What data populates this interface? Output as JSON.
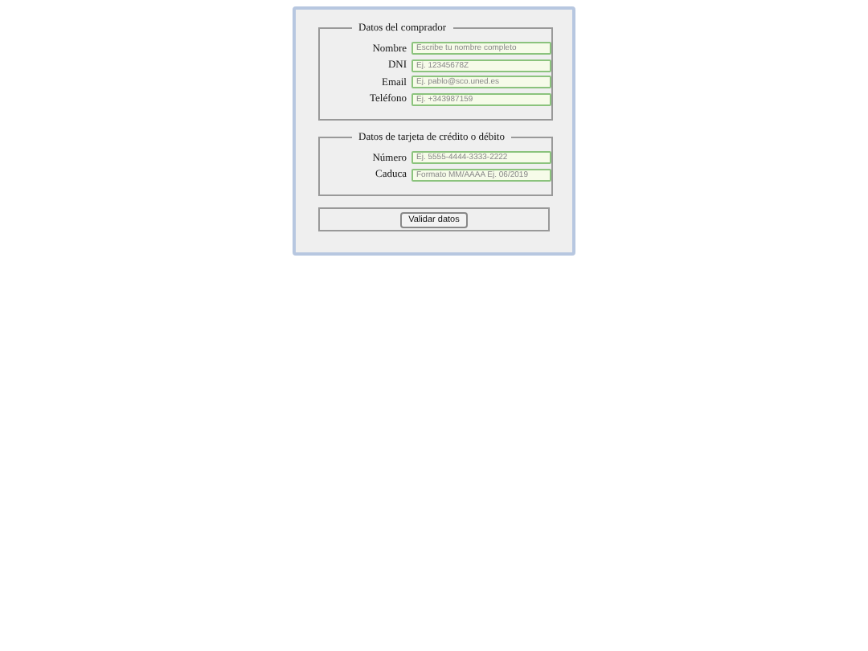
{
  "sections": [
    {
      "legend": "Datos del comprador",
      "fields": [
        {
          "label": "Nombre",
          "placeholder": "Escribe tu nombre completo"
        },
        {
          "label": "DNI",
          "placeholder": "Ej. 12345678Z"
        },
        {
          "label": "Email",
          "placeholder": "Ej. pablo@sco.uned.es"
        },
        {
          "label": "Teléfono",
          "placeholder": "Ej. +343987159"
        }
      ]
    },
    {
      "legend": "Datos de tarjeta de crédito o débito",
      "fields": [
        {
          "label": "Número",
          "placeholder": "Ej. 5555-4444-3333-2222"
        },
        {
          "label": "Caduca",
          "placeholder": "Formato MM/AAAA Ej. 06/2019"
        }
      ]
    }
  ],
  "submit": "Validar datos"
}
